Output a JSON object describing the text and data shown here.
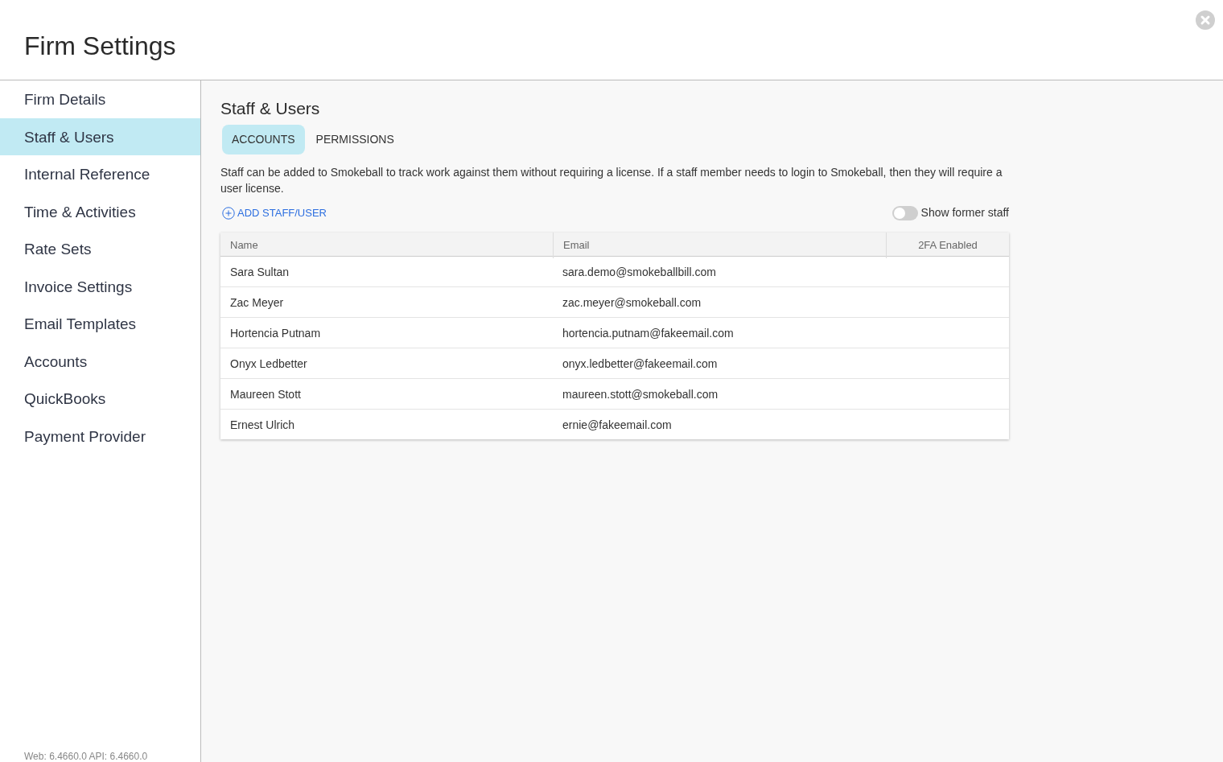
{
  "window": {
    "title": "Firm Settings"
  },
  "sidebar": {
    "items": [
      {
        "label": "Firm Details",
        "selected": false
      },
      {
        "label": "Staff & Users",
        "selected": true
      },
      {
        "label": "Internal Reference",
        "selected": false
      },
      {
        "label": "Time & Activities",
        "selected": false
      },
      {
        "label": "Rate Sets",
        "selected": false
      },
      {
        "label": "Invoice Settings",
        "selected": false
      },
      {
        "label": "Email Templates",
        "selected": false
      },
      {
        "label": "Accounts",
        "selected": false
      },
      {
        "label": "QuickBooks",
        "selected": false
      },
      {
        "label": "Payment Provider",
        "selected": false
      }
    ],
    "version": "Web: 6.4660.0 API: 6.4660.0"
  },
  "content": {
    "title": "Staff & Users",
    "tabs": [
      {
        "label": "ACCOUNTS",
        "selected": true
      },
      {
        "label": "PERMISSIONS",
        "selected": false
      }
    ],
    "description": "Staff can be added to Smokeball to track work against them without requiring a license. If a staff member needs to login to Smokeball, then they will require a user license.",
    "add_button": "ADD STAFF/USER",
    "show_former_staff": {
      "label": "Show former staff",
      "on": false
    },
    "table": {
      "columns": [
        "Name",
        "Email",
        "2FA Enabled"
      ],
      "rows": [
        [
          "Sara Sultan",
          "sara.demo@smokeballbill.com"
        ],
        [
          "Zac Meyer",
          "zac.meyer@smokeball.com"
        ],
        [
          "Hortencia Putnam",
          "hortencia.putnam@fakeemail.com"
        ],
        [
          "Onyx Ledbetter",
          "onyx.ledbetter@fakeemail.com"
        ],
        [
          "Maureen Stott",
          "maureen.stott@smokeball.com"
        ],
        [
          "Ernest Ulrich",
          "ernie@fakeemail.com"
        ]
      ]
    }
  }
}
